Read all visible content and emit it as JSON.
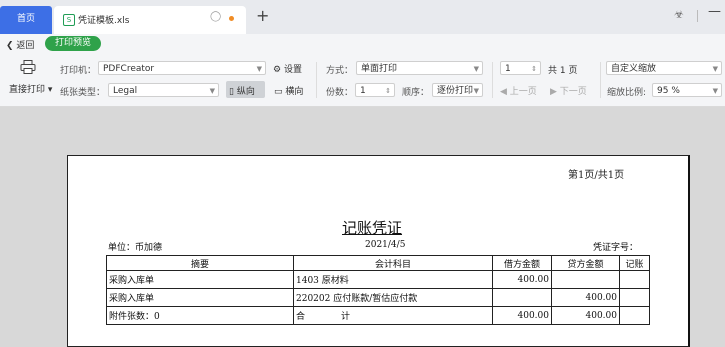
{
  "tabs": {
    "home": "首页",
    "doc": "凭证模板.xls",
    "doc_icon": "S"
  },
  "toolbar": {
    "back": "返回",
    "preview": "打印预览",
    "direct_print": "直接打印",
    "printer_label": "打印机：",
    "printer_value": "PDFCreator",
    "settings": "设置",
    "paper_label": "纸张类型：",
    "paper_value": "Legal",
    "portrait": "纵向",
    "landscape": "横向",
    "mode_label": "方式：",
    "mode_value": "单面打印",
    "copies_label": "份数：",
    "copies_value": "1",
    "order_label": "顺序：",
    "order_value": "逐份打印",
    "page_value": "1",
    "total_pages": "共 1 页",
    "prev_page": "上一页",
    "next_page": "下一页",
    "zoom_mode": "自定义缩放",
    "zoom_label": "缩放比例:",
    "zoom_value": "95 %"
  },
  "paper": {
    "page_indicator": "第1页/共1页",
    "title": "记账凭证",
    "unit": "单位：币加德",
    "date": "2021/4/5",
    "voucher_no": "凭证字号：",
    "headers": [
      "摘要",
      "会计科目",
      "借方金额",
      "贷方金额",
      "记账"
    ],
    "rows": [
      [
        "采购入库单",
        "1403 原材料",
        "400.00",
        "",
        ""
      ],
      [
        "采购入库单",
        "220202 应付账款/暂估应付款",
        "",
        "400.00",
        ""
      ],
      [
        "附件张数：0",
        "合　　　　计",
        "400.00",
        "400.00",
        ""
      ]
    ]
  }
}
